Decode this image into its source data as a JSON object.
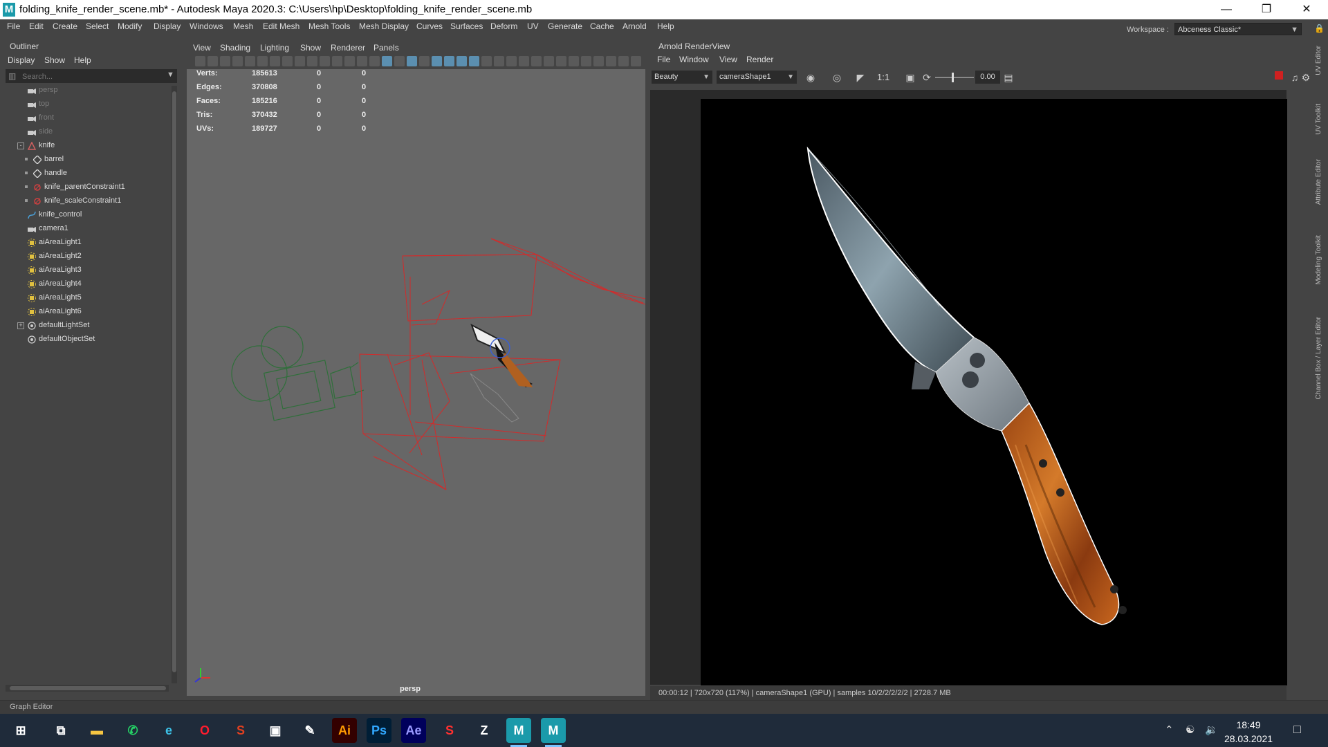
{
  "window": {
    "title": "folding_knife_render_scene.mb* - Autodesk Maya 2020.3: C:\\Users\\hp\\Desktop\\folding_knife_render_scene.mb",
    "app_icon_letter": "M",
    "controls": [
      "minimize",
      "restore",
      "close"
    ]
  },
  "menubar": {
    "items": [
      "File",
      "Edit",
      "Create",
      "Select",
      "Modify",
      "Display",
      "Windows",
      "Mesh",
      "Edit Mesh",
      "Mesh Tools",
      "Mesh Display",
      "Curves",
      "Surfaces",
      "Deform",
      "UV",
      "Generate",
      "Cache",
      "Arnold",
      "Help"
    ],
    "workspace_label": "Workspace :",
    "workspace_value": "Abceness Classic*"
  },
  "outliner": {
    "title": "Outliner",
    "menu": [
      "Display",
      "Show",
      "Help"
    ],
    "search_placeholder": "Search...",
    "items": [
      {
        "label": "persp",
        "icon": "camera-icon",
        "dim": true
      },
      {
        "label": "top",
        "icon": "camera-icon",
        "dim": true
      },
      {
        "label": "front",
        "icon": "camera-icon",
        "dim": true
      },
      {
        "label": "side",
        "icon": "camera-icon",
        "dim": true
      },
      {
        "label": "knife",
        "icon": "transform-icon",
        "expander": "-"
      },
      {
        "label": "barrel",
        "icon": "mesh-icon",
        "child": true
      },
      {
        "label": "handle",
        "icon": "mesh-icon",
        "child": true
      },
      {
        "label": "knife_parentConstraint1",
        "icon": "constraint-icon",
        "child": true
      },
      {
        "label": "knife_scaleConstraint1",
        "icon": "constraint-icon",
        "child": true
      },
      {
        "label": "knife_control",
        "icon": "curve-icon"
      },
      {
        "label": "camera1",
        "icon": "camera-icon"
      },
      {
        "label": "aiAreaLight1",
        "icon": "light-icon"
      },
      {
        "label": "aiAreaLight2",
        "icon": "light-icon"
      },
      {
        "label": "aiAreaLight3",
        "icon": "light-icon"
      },
      {
        "label": "aiAreaLight4",
        "icon": "light-icon"
      },
      {
        "label": "aiAreaLight5",
        "icon": "light-icon"
      },
      {
        "label": "aiAreaLight6",
        "icon": "light-icon"
      },
      {
        "label": "defaultLightSet",
        "icon": "set-icon",
        "expander": "+"
      },
      {
        "label": "defaultObjectSet",
        "icon": "set-icon"
      }
    ]
  },
  "viewport": {
    "menu": [
      "View",
      "Shading",
      "Lighting",
      "Show",
      "Renderer",
      "Panels"
    ],
    "hud": [
      {
        "label": "Verts:",
        "total": "185613",
        "selected": "0",
        "third": "0"
      },
      {
        "label": "Edges:",
        "total": "370808",
        "selected": "0",
        "third": "0"
      },
      {
        "label": "Faces:",
        "total": "185216",
        "selected": "0",
        "third": "0"
      },
      {
        "label": "Tris:",
        "total": "370432",
        "selected": "0",
        "third": "0"
      },
      {
        "label": "UVs:",
        "total": "189727",
        "selected": "0",
        "third": "0"
      }
    ],
    "camera_label": "persp"
  },
  "renderview": {
    "title": "Arnold RenderView",
    "menu": [
      "File",
      "Window",
      "View",
      "Render"
    ],
    "aov": "Beauty",
    "camera": "cameraShape1",
    "ratio": "1:1",
    "exposure": "0.00",
    "status": "00:00:12 | 720x720 (117%) | cameraShape1  (GPU) | samples 10/2/2/2/2/2 | 2728.7 MB"
  },
  "side_tabs": [
    "UV Editor",
    "UV Toolkit",
    "Attribute Editor",
    "Modeling Toolkit",
    "Channel Box / Layer Editor"
  ],
  "bottom_panel": {
    "label": "Graph Editor"
  },
  "taskbar": {
    "apps": [
      {
        "name": "windows-start-icon",
        "glyph": "⊞"
      },
      {
        "name": "task-view-icon",
        "glyph": "⧉"
      },
      {
        "name": "file-explorer-icon",
        "glyph": "▬"
      },
      {
        "name": "whatsapp-icon",
        "glyph": "✆"
      },
      {
        "name": "edge-icon",
        "glyph": "e"
      },
      {
        "name": "opera-icon",
        "glyph": "O"
      },
      {
        "name": "substance-painter-icon",
        "glyph": "S"
      },
      {
        "name": "app-window-icon",
        "glyph": "▣"
      },
      {
        "name": "pencil-app-icon",
        "glyph": "✎"
      },
      {
        "name": "illustrator-icon",
        "glyph": "Ai"
      },
      {
        "name": "photoshop-icon",
        "glyph": "Ps"
      },
      {
        "name": "after-effects-icon",
        "glyph": "Ae"
      },
      {
        "name": "substance-icon",
        "glyph": "S"
      },
      {
        "name": "zbrush-icon",
        "glyph": "Z"
      },
      {
        "name": "maya-icon",
        "glyph": "M"
      },
      {
        "name": "maya-icon-2",
        "glyph": "M"
      }
    ],
    "time": "18:49",
    "date": "28.03.2021"
  },
  "colors": {
    "accent_blue": "#5b8fb0",
    "render_stop": "#d02020",
    "wireframe_red": "#d42a2a",
    "camera_green": "#2f6f3a"
  }
}
